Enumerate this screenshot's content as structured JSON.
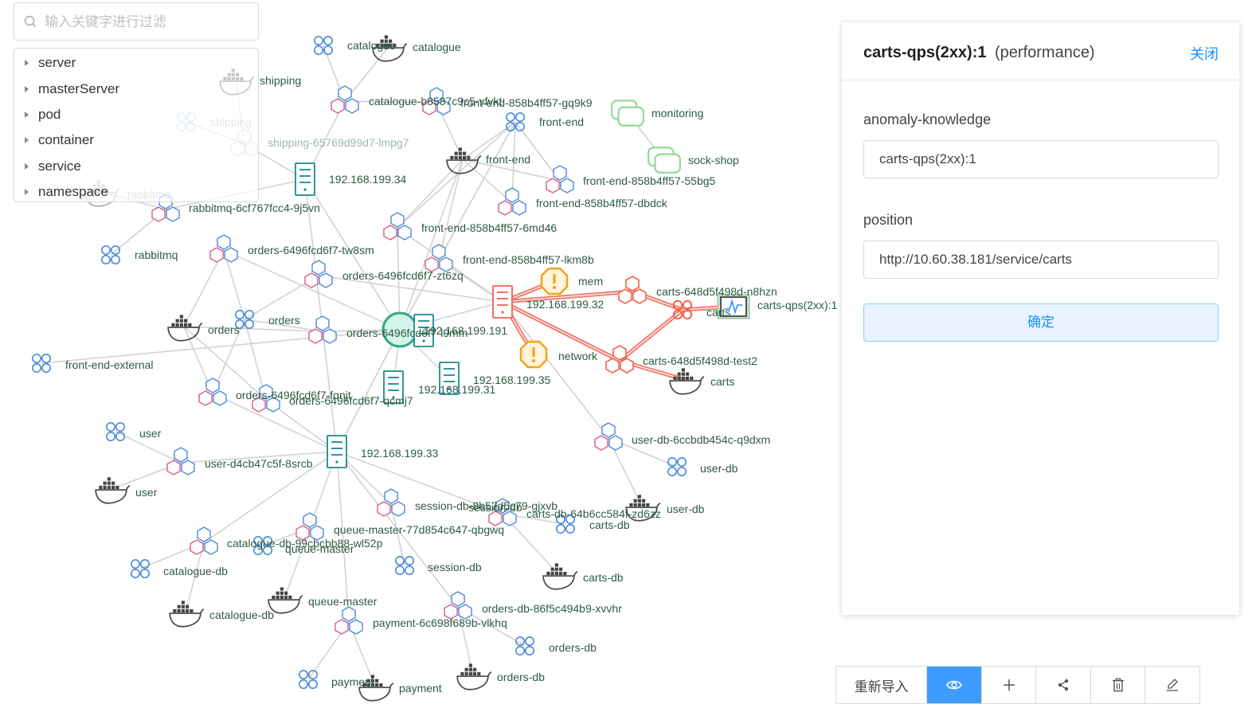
{
  "search": {
    "placeholder": "输入关键字进行过滤"
  },
  "tree": [
    "server",
    "masterServer",
    "pod",
    "container",
    "service",
    "namespace"
  ],
  "panel": {
    "title": "carts-qps(2xx):1",
    "subtitle": "(performance)",
    "close": "关闭",
    "fields": [
      {
        "label": "anomaly-knowledge",
        "value": "carts-qps(2xx):1"
      },
      {
        "label": "position",
        "value": "http://10.60.38.181/service/carts"
      }
    ],
    "confirm": "确定"
  },
  "toolbar": {
    "reimport": "重新导入",
    "buttons": [
      "eye-icon",
      "plus-icon",
      "share-icon",
      "delete-icon",
      "edit-icon"
    ]
  },
  "colors": {
    "accent": "#1890ff",
    "anomaly": "#f0624d",
    "warning": "#f5a31a",
    "server": "#1a8a8a",
    "service": "#4a8ad8",
    "namespace": "#8ed88e"
  },
  "graph": {
    "nodes": [
      {
        "id": "cat_svc",
        "type": "service",
        "label": "catalogue"
      },
      {
        "id": "cat_ct",
        "type": "container",
        "label": "catalogue"
      },
      {
        "id": "cat_pod",
        "type": "pod",
        "label": "catalogue-b8587c9c5-vfvkt"
      },
      {
        "id": "shipping_ct",
        "type": "container",
        "label": "shipping"
      },
      {
        "id": "shipping_svc",
        "type": "service",
        "label": "shipping",
        "faded": true
      },
      {
        "id": "shipping_pod",
        "type": "pod",
        "label": "shipping-65769d99d7-lmpg7",
        "faded": true
      },
      {
        "id": "srv34",
        "type": "server",
        "label": "192.168.199.34"
      },
      {
        "id": "rabbit_ct",
        "type": "container",
        "label": "rabbitmq",
        "faded": true
      },
      {
        "id": "rabbit_pod",
        "type": "pod",
        "label": "rabbitmq-6cf767fcc4-9j5vn"
      },
      {
        "id": "rabbit_svc",
        "type": "service",
        "label": "rabbitmq"
      },
      {
        "id": "fe_pod_gq",
        "type": "pod",
        "label": "front-end-858b4ff57-gq9k9"
      },
      {
        "id": "fe_svc",
        "type": "service",
        "label": "front-end"
      },
      {
        "id": "fe_ct",
        "type": "container",
        "label": "front-end"
      },
      {
        "id": "monitoring",
        "type": "namespace",
        "label": "monitoring"
      },
      {
        "id": "sockshop",
        "type": "namespace",
        "label": "sock-shop"
      },
      {
        "id": "fe_pod_55",
        "type": "pod",
        "label": "front-end-858b4ff57-55bg5"
      },
      {
        "id": "fe_pod_db",
        "type": "pod",
        "label": "front-end-858b4ff57-dbdck"
      },
      {
        "id": "fe_pod_6m",
        "type": "pod",
        "label": "front-end-858b4ff57-6md46"
      },
      {
        "id": "orders_pod_tw",
        "type": "pod",
        "label": "orders-6496fcd6f7-tw8sm"
      },
      {
        "id": "fe_pod_lk",
        "type": "pod",
        "label": "front-end-858b4ff57-lkm8b"
      },
      {
        "id": "orders_pod_zt",
        "type": "pod",
        "label": "orders-6496fcd6f7-zt6zq"
      },
      {
        "id": "srv32",
        "type": "server",
        "label": "192.168.199.32",
        "anomaly": true
      },
      {
        "id": "mem",
        "type": "warning",
        "label": "mem"
      },
      {
        "id": "network",
        "type": "warning",
        "label": "network"
      },
      {
        "id": "carts_pod_n8",
        "type": "pod",
        "label": "carts-648d5f498d-n8hzn",
        "anomaly": true
      },
      {
        "id": "carts_svc",
        "type": "service",
        "label": "carts",
        "anomaly": true
      },
      {
        "id": "carts_qps",
        "type": "metric",
        "label": "carts-qps(2xx):1"
      },
      {
        "id": "carts_pod_t2",
        "type": "pod",
        "label": "carts-648d5f498d-test2",
        "anomaly": true
      },
      {
        "id": "carts_ct",
        "type": "container",
        "label": "carts"
      },
      {
        "id": "orders_ct",
        "type": "container",
        "label": "orders"
      },
      {
        "id": "orders_svc",
        "type": "service",
        "label": "orders"
      },
      {
        "id": "orders_pod_l9",
        "type": "pod",
        "label": "orders-6496fcd6f7-l9mm"
      },
      {
        "id": "hub",
        "type": "hub",
        "label": ""
      },
      {
        "id": "srv191",
        "type": "server",
        "label": "192.168.199.191"
      },
      {
        "id": "fe_ext",
        "type": "service",
        "label": "front-end-external"
      },
      {
        "id": "srv35",
        "type": "server",
        "label": "192.168.199.35"
      },
      {
        "id": "srv31",
        "type": "server",
        "label": "192.168.199.31"
      },
      {
        "id": "orders_pod_fq",
        "type": "pod",
        "label": "orders-6496fcd6f7-fqnjt"
      },
      {
        "id": "orders_pod_qc",
        "type": "pod",
        "label": "orders-6496fcd6f7-qcmj7"
      },
      {
        "id": "userdb_pod",
        "type": "pod",
        "label": "user-db-6ccbdb454c-q9dxm"
      },
      {
        "id": "userdb_svc",
        "type": "service",
        "label": "user-db"
      },
      {
        "id": "userdb_ct",
        "type": "container",
        "label": "user-db"
      },
      {
        "id": "user_svc",
        "type": "service",
        "label": "user"
      },
      {
        "id": "user_pod",
        "type": "pod",
        "label": "user-d4cb47c5f-8srcb"
      },
      {
        "id": "user_ct",
        "type": "container",
        "label": "user"
      },
      {
        "id": "srv33",
        "type": "server",
        "label": "192.168.199.33"
      },
      {
        "id": "session_pod",
        "type": "pod",
        "label": "session-db-8b57d5c79-gjxvb"
      },
      {
        "id": "session_lbl",
        "type": "label",
        "label": "session-db"
      },
      {
        "id": "cartsdb_pod",
        "type": "pod",
        "label": "carts-db-64b6cc584f-zd6zz"
      },
      {
        "id": "cartsdb_svc",
        "type": "service",
        "label": "carts-db"
      },
      {
        "id": "cartsdb_ct",
        "type": "container",
        "label": "carts-db"
      },
      {
        "id": "catdb_pod",
        "type": "pod",
        "label": "catalogue-db-99cbcbb88-wl52p"
      },
      {
        "id": "qm_pod",
        "type": "pod",
        "label": "queue-master-77d854c647-qbgwq"
      },
      {
        "id": "qm_svc",
        "type": "service",
        "label": "queue-master"
      },
      {
        "id": "catdb_svc",
        "type": "service",
        "label": "catalogue-db"
      },
      {
        "id": "session_svc",
        "type": "service",
        "label": "session-db"
      },
      {
        "id": "qm_ct",
        "type": "container",
        "label": "queue-master"
      },
      {
        "id": "catdb_ct",
        "type": "container",
        "label": "catalogue-db"
      },
      {
        "id": "ordersdb_pod",
        "type": "pod",
        "label": "orders-db-86f5c494b9-xvvhr"
      },
      {
        "id": "payment_pod",
        "type": "pod",
        "label": "payment-6c698f689b-vlkhq"
      },
      {
        "id": "ordersdb_svc",
        "type": "service",
        "label": "orders-db"
      },
      {
        "id": "ordersdb_ct",
        "type": "container",
        "label": "orders-db"
      },
      {
        "id": "payment_svc",
        "type": "service",
        "label": "payment"
      },
      {
        "id": "payment_ct",
        "type": "container",
        "label": "payment"
      }
    ],
    "edges": [
      [
        "cat_svc",
        "cat_pod"
      ],
      [
        "cat_ct",
        "cat_pod"
      ],
      [
        "cat_pod",
        "srv34"
      ],
      [
        "shipping_pod",
        "srv34"
      ],
      [
        "shipping_ct",
        "shipping_pod"
      ],
      [
        "shipping_svc",
        "shipping_pod"
      ],
      [
        "rabbit_pod",
        "srv34"
      ],
      [
        "rabbit_svc",
        "rabbit_pod"
      ],
      [
        "rabbit_ct",
        "rabbit_pod"
      ],
      [
        "srv34",
        "srv33"
      ],
      [
        "srv34",
        "hub"
      ],
      [
        "fe_pod_gq",
        "fe_ct"
      ],
      [
        "cat_pod",
        "fe_pod_gq"
      ],
      [
        "fe_svc",
        "fe_ct"
      ],
      [
        "monitoring",
        "sockshop"
      ],
      [
        "fe_svc",
        "fe_pod_55"
      ],
      [
        "fe_svc",
        "fe_pod_db"
      ],
      [
        "fe_svc",
        "fe_pod_6m"
      ],
      [
        "fe_ct",
        "fe_pod_55"
      ],
      [
        "fe_ct",
        "fe_pod_db"
      ],
      [
        "fe_ct",
        "fe_pod_6m"
      ],
      [
        "fe_ct",
        "fe_pod_lk"
      ],
      [
        "fe_svc",
        "fe_pod_lk"
      ],
      [
        "fe_ct",
        "hub"
      ],
      [
        "fe_svc",
        "hub"
      ],
      [
        "fe_pod_6m",
        "hub"
      ],
      [
        "fe_pod_lk",
        "hub"
      ],
      [
        "fe_pod_6m",
        "srv32"
      ],
      [
        "fe_pod_lk",
        "srv32"
      ],
      [
        "orders_pod_tw",
        "orders_ct"
      ],
      [
        "orders_pod_tw",
        "orders_svc"
      ],
      [
        "orders_pod_tw",
        "hub"
      ],
      [
        "orders_pod_zt",
        "srv32"
      ],
      [
        "orders_pod_zt",
        "orders_svc"
      ],
      [
        "orders_ct",
        "orders_pod_l9"
      ],
      [
        "orders_svc",
        "orders_pod_l9"
      ],
      [
        "orders_pod_l9",
        "hub"
      ],
      [
        "hub",
        "srv32"
      ],
      [
        "hub",
        "srv33"
      ],
      [
        "orders_ct",
        "orders_pod_fq"
      ],
      [
        "orders_svc",
        "orders_pod_fq"
      ],
      [
        "orders_ct",
        "orders_pod_qc"
      ],
      [
        "orders_svc",
        "orders_pod_qc"
      ],
      [
        "orders_pod_fq",
        "srv33"
      ],
      [
        "orders_pod_qc",
        "srv33"
      ],
      [
        "srv32",
        "userdb_pod"
      ],
      [
        "userdb_pod",
        "userdb_svc"
      ],
      [
        "userdb_pod",
        "userdb_ct"
      ],
      [
        "user_svc",
        "user_pod"
      ],
      [
        "user_ct",
        "user_pod"
      ],
      [
        "user_pod",
        "srv33"
      ],
      [
        "srv33",
        "session_pod"
      ],
      [
        "srv33",
        "cartsdb_pod"
      ],
      [
        "srv33",
        "catdb_pod"
      ],
      [
        "srv33",
        "qm_pod"
      ],
      [
        "srv33",
        "ordersdb_pod"
      ],
      [
        "srv33",
        "payment_pod"
      ],
      [
        "srv33",
        "hub"
      ],
      [
        "cartsdb_pod",
        "cartsdb_svc"
      ],
      [
        "cartsdb_pod",
        "cartsdb_ct"
      ],
      [
        "catdb_pod",
        "catdb_svc"
      ],
      [
        "catdb_pod",
        "catdb_ct"
      ],
      [
        "qm_pod",
        "qm_svc"
      ],
      [
        "qm_pod",
        "qm_ct"
      ],
      [
        "session_pod",
        "session_svc"
      ],
      [
        "ordersdb_pod",
        "ordersdb_svc"
      ],
      [
        "ordersdb_pod",
        "ordersdb_ct"
      ],
      [
        "payment_pod",
        "payment_svc"
      ],
      [
        "payment_pod",
        "payment_ct"
      ],
      [
        "srv191",
        "hub"
      ],
      [
        "srv35",
        "hub"
      ],
      [
        "srv31",
        "hub"
      ],
      [
        "fe_ext",
        "hub"
      ]
    ],
    "anomaly_edges": [
      [
        "srv32",
        "mem"
      ],
      [
        "srv32",
        "network"
      ],
      [
        "srv32",
        "carts_pod_n8"
      ],
      [
        "srv32",
        "carts_pod_t2"
      ],
      [
        "carts_pod_n8",
        "carts_svc"
      ],
      [
        "carts_pod_t2",
        "carts_svc"
      ],
      [
        "carts_svc",
        "carts_qps"
      ],
      [
        "carts_pod_t2",
        "carts_ct"
      ]
    ]
  }
}
